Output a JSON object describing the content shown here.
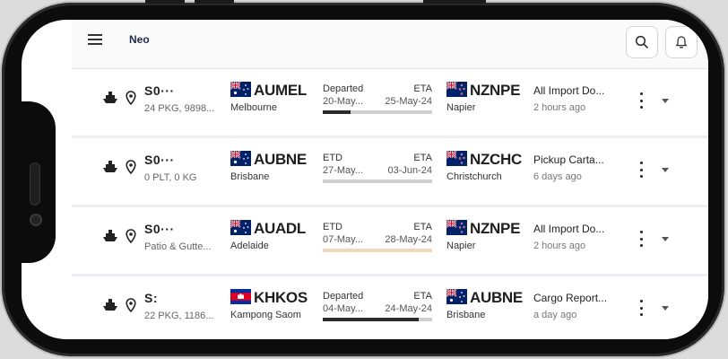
{
  "app": {
    "brand": "Neo"
  },
  "header": {
    "search_icon": "search-icon",
    "bell_icon": "bell-icon"
  },
  "colors": {
    "progress_dark": "#2b2b2b",
    "progress_pending": "#cfcfcf",
    "progress_warning": "#f6d6b8"
  },
  "shipments": [
    {
      "ref": "S0···",
      "sub": "24 PKG, 9898...",
      "origin": {
        "code": "AUMEL",
        "city": "Melbourne",
        "flag": "au"
      },
      "phase_label": "Departed",
      "eta_label": "ETA",
      "phase_date": "20-May...",
      "eta_date": "25-May-24",
      "progress": 0.25,
      "progress_color": "#2b2b2b",
      "dest": {
        "code": "NZNPE",
        "city": "Napier",
        "flag": "nz"
      },
      "status": "All Import Do...",
      "time": "2 hours ago"
    },
    {
      "ref": "S0···",
      "sub": "0 PLT, 0 KG",
      "origin": {
        "code": "AUBNE",
        "city": "Brisbane",
        "flag": "au"
      },
      "phase_label": "ETD",
      "eta_label": "ETA",
      "phase_date": "27-May...",
      "eta_date": "03-Jun-24",
      "progress": 0,
      "progress_color": "#2b2b2b",
      "dest": {
        "code": "NZCHC",
        "city": "Christchurch",
        "flag": "nz"
      },
      "status": "Pickup Carta...",
      "time": "6 days ago"
    },
    {
      "ref": "S0···",
      "sub": "Patio & Gutte...",
      "origin": {
        "code": "AUADL",
        "city": "Adelaide",
        "flag": "au"
      },
      "phase_label": "ETD",
      "eta_label": "ETA",
      "phase_date": "07-May...",
      "eta_date": "28-May-24",
      "progress": 1,
      "progress_color": "#f6d6b8",
      "dest": {
        "code": "NZNPE",
        "city": "Napier",
        "flag": "nz"
      },
      "status": "All Import Do...",
      "time": "2 hours ago"
    },
    {
      "ref": "S:",
      "sub": "22 PKG, 1186...",
      "origin": {
        "code": "KHKOS",
        "city": "Kampong Saom",
        "flag": "kh"
      },
      "phase_label": "Departed",
      "eta_label": "ETA",
      "phase_date": "04-May...",
      "eta_date": "24-May-24",
      "progress": 0.88,
      "progress_color": "#2b2b2b",
      "dest": {
        "code": "AUBNE",
        "city": "Brisbane",
        "flag": "au"
      },
      "status": "Cargo Report...",
      "time": "a day ago"
    }
  ]
}
